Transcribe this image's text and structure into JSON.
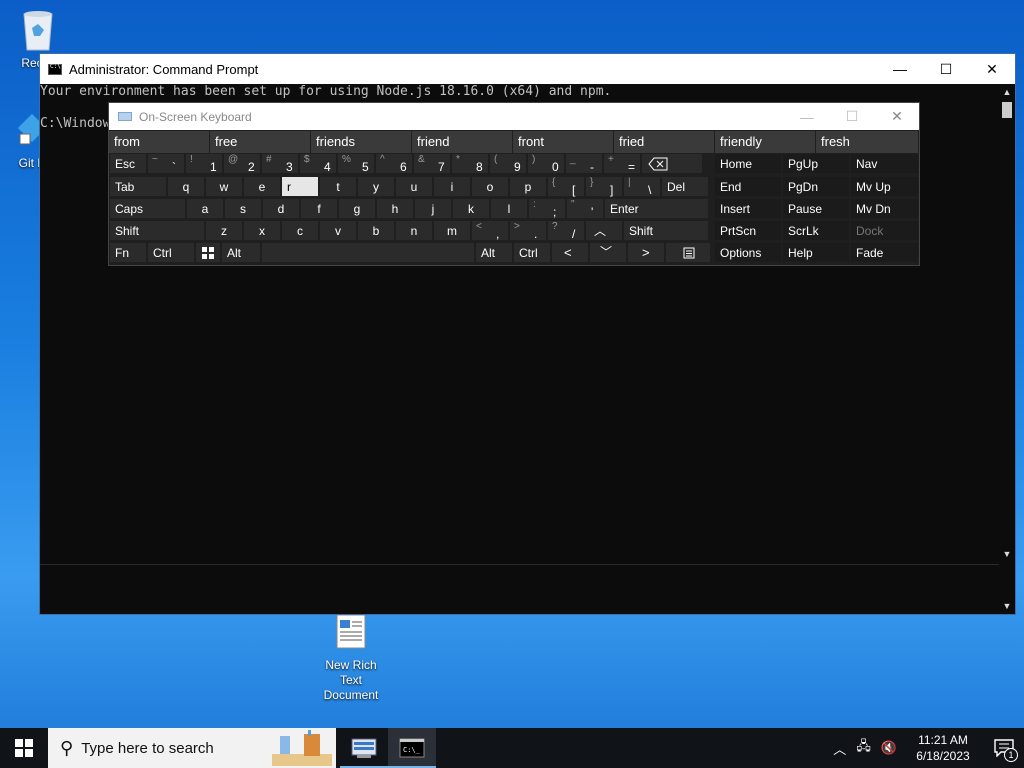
{
  "desktop": {
    "icons": [
      {
        "label": "Recycle Bin",
        "shown": "Recyc"
      },
      {
        "label": "Git Bash",
        "shown": "Git B"
      },
      {
        "label": "New Rich Text Document",
        "line1": "New Rich Text",
        "line2": "Document"
      }
    ]
  },
  "cmd": {
    "title": "Administrator:  Command Prompt",
    "line1": "Your environment has been set up for using Node.js 18.16.0 (x64) and npm.",
    "line2": "C:\\Window",
    "minimize": "—",
    "maximize": "☐",
    "close": "✕"
  },
  "osk": {
    "title": "On-Screen Keyboard",
    "predictions": [
      "from",
      "free",
      "friends",
      "friend",
      "front",
      "fried",
      "friendly",
      "fresh"
    ],
    "keys": {
      "esc": "Esc",
      "tab": "Tab",
      "caps": "Caps",
      "shift": "Shift",
      "fn": "Fn",
      "ctrl": "Ctrl",
      "alt": "Alt",
      "del": "Del",
      "enter": "Enter",
      "alt_r": "Alt",
      "ctrl_r": "Ctrl",
      "shift_r": "Shift",
      "home": "Home",
      "pgup": "PgUp",
      "nav": "Nav",
      "end": "End",
      "pgdn": "PgDn",
      "mvup": "Mv Up",
      "insert": "Insert",
      "pause": "Pause",
      "mvdn": "Mv Dn",
      "prtscn": "PrtScn",
      "scrlk": "ScrLk",
      "dock": "Dock",
      "options": "Options",
      "help": "Help",
      "fade": "Fade",
      "row1": [
        [
          "~",
          "`"
        ],
        [
          "!",
          "1"
        ],
        [
          "@",
          "2"
        ],
        [
          "#",
          "3"
        ],
        [
          "$",
          "4"
        ],
        [
          "%",
          "5"
        ],
        [
          "^",
          "6"
        ],
        [
          "&",
          "7"
        ],
        [
          "*",
          "8"
        ],
        [
          "(",
          "9"
        ],
        [
          ")",
          "0"
        ],
        [
          "_",
          "-"
        ],
        [
          "+",
          "="
        ]
      ],
      "row2": [
        "q",
        "w",
        "e",
        "r",
        "t",
        "y",
        "u",
        "i",
        "o",
        "p"
      ],
      "row2sym": [
        [
          "{",
          "["
        ],
        [
          "}",
          "]"
        ],
        [
          "|",
          "\\"
        ]
      ],
      "row3": [
        "a",
        "s",
        "d",
        "f",
        "g",
        "h",
        "j",
        "k",
        "l"
      ],
      "row3sym": [
        [
          ":",
          ";"
        ],
        [
          "\"",
          "'"
        ]
      ],
      "row4": [
        "z",
        "x",
        "c",
        "v",
        "b",
        "n",
        "m"
      ],
      "row4sym": [
        [
          "<",
          ","
        ],
        [
          ">",
          "."
        ],
        [
          "?",
          "/"
        ]
      ]
    }
  },
  "taskbar": {
    "search_placeholder": "Type here to search",
    "time": "11:21 AM",
    "date": "6/18/2023",
    "notification_count": "1"
  }
}
